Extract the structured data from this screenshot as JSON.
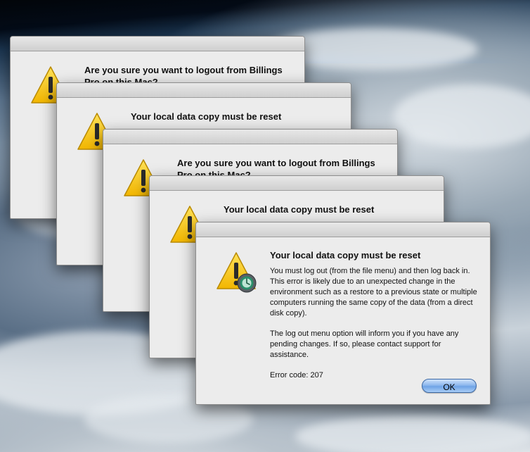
{
  "wallpaper": {
    "name": "earth-from-orbit"
  },
  "dialogs": [
    {
      "title": "Are you sure you want to logout from Billings Pro on this Mac?"
    },
    {
      "title": "Your local data copy must be reset"
    },
    {
      "title": "Are you sure you want to logout from Billings Pro on this Mac?"
    },
    {
      "title": "Your local data copy must be reset"
    }
  ],
  "alert": {
    "title": "Your local data copy must be reset",
    "body_paragraph_1": "You must log out (from the file menu) and then log back in. This error is likely due to an unexpected change in the environment such as a restore to a previous state or multiple computers running the same copy of the data (from a direct disk copy).",
    "body_paragraph_2": "The log out menu option will inform you if you have any pending changes. If so, please contact support for assistance.",
    "error_code": "Error code: 207",
    "ok_label": "OK",
    "icon": "warning-triangle-icon",
    "badge_icon": "billings-app-badge-icon",
    "accent_color": "#6fa3e6"
  }
}
